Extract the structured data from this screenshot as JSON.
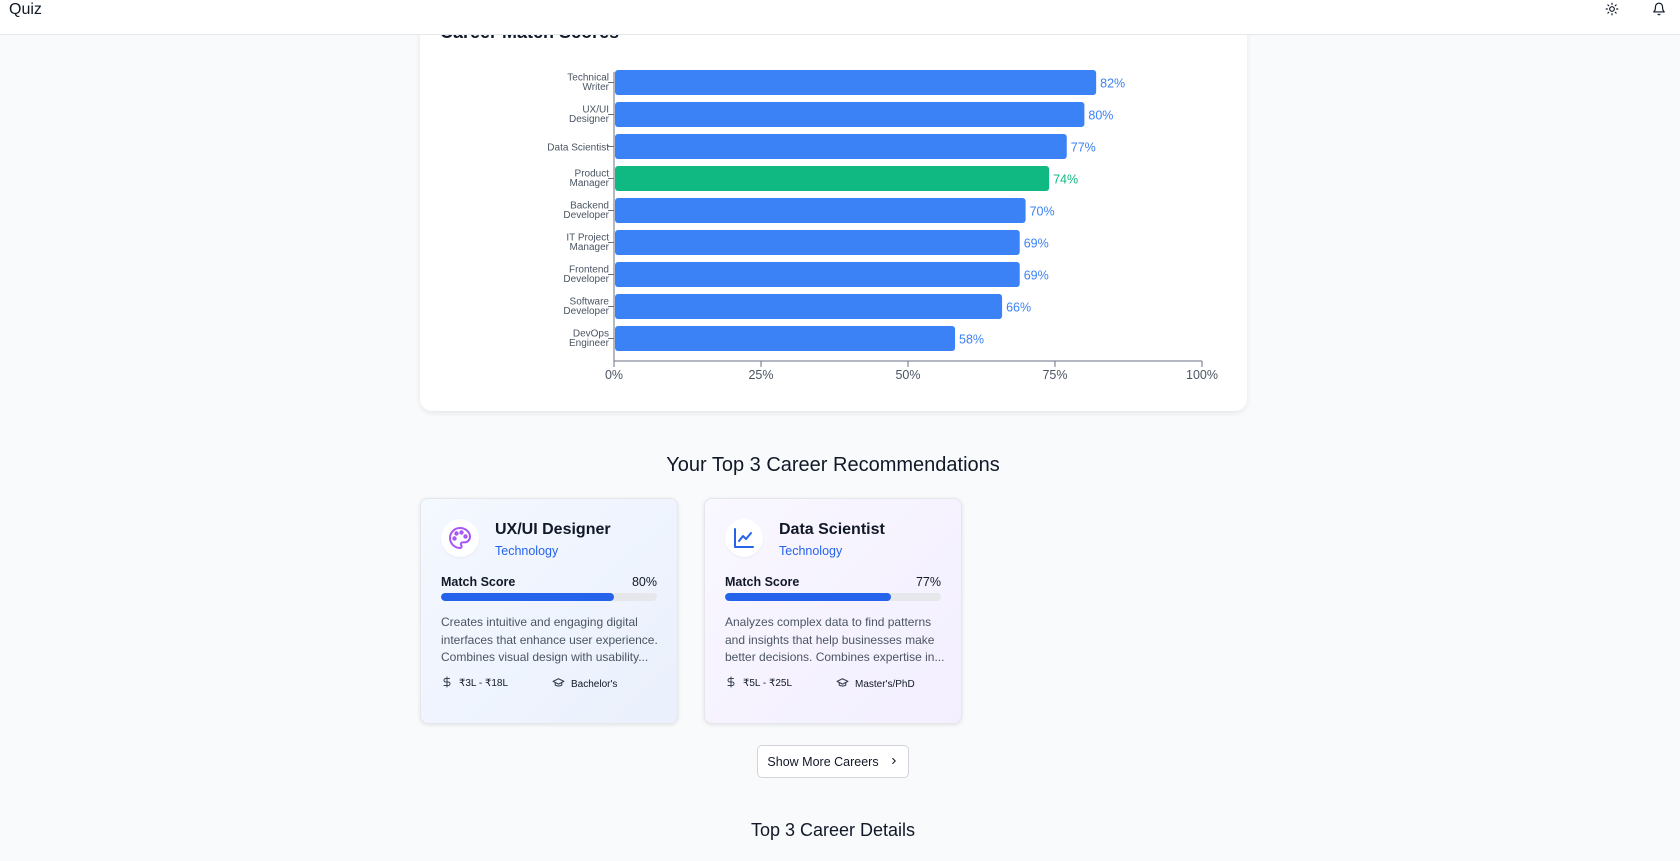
{
  "topbar": {
    "title": "Quiz",
    "icons": [
      "sun-icon",
      "bell-icon"
    ]
  },
  "chart_section": {
    "title": "Career Match Scores"
  },
  "chart_data": {
    "type": "bar",
    "orientation": "horizontal",
    "categories": [
      [
        "Technical",
        "Writer"
      ],
      [
        "UX/UI",
        "Designer"
      ],
      [
        "Data Scientist"
      ],
      [
        "Product",
        "Manager"
      ],
      [
        "Backend",
        "Developer"
      ],
      [
        "IT Project",
        "Manager"
      ],
      [
        "Frontend",
        "Developer"
      ],
      [
        "Software",
        "Developer"
      ],
      [
        "DevOps",
        "Engineer"
      ]
    ],
    "values": [
      82,
      80,
      77,
      74,
      70,
      69,
      69,
      66,
      58
    ],
    "value_labels": [
      "82%",
      "80%",
      "77%",
      "74%",
      "70%",
      "69%",
      "69%",
      "66%",
      "58%"
    ],
    "highlight_index": 3,
    "xlim": [
      0,
      100
    ],
    "xticks": [
      "0%",
      "25%",
      "50%",
      "75%",
      "100%"
    ],
    "colors": {
      "default": "#3b82f6",
      "highlight": "#10b981"
    },
    "grid": false,
    "legend": "none"
  },
  "recommendations": {
    "title": "Your Top 3 Career Recommendations",
    "cards": [
      {
        "icon": "palette-icon",
        "title": "UX/UI Designer",
        "category": "Technology",
        "match_label": "Match Score",
        "match_value": "80%",
        "match_fraction": 0.8,
        "description": "Creates intuitive and engaging digital interfaces that enhance user experience. Combines visual design with usability...",
        "salary": "₹3L - ₹18L",
        "education": "Bachelor's"
      },
      {
        "icon": "line-chart-icon",
        "title": "Data Scientist",
        "category": "Technology",
        "match_label": "Match Score",
        "match_value": "77%",
        "match_fraction": 0.77,
        "description": "Analyzes complex data to find patterns and insights that help businesses make better decisions. Combines expertise in...",
        "salary": "₹5L - ₹25L",
        "education": "Master's/PhD"
      }
    ],
    "show_more_label": "Show More Careers"
  },
  "details": {
    "title": "Top 3 Career Details"
  }
}
